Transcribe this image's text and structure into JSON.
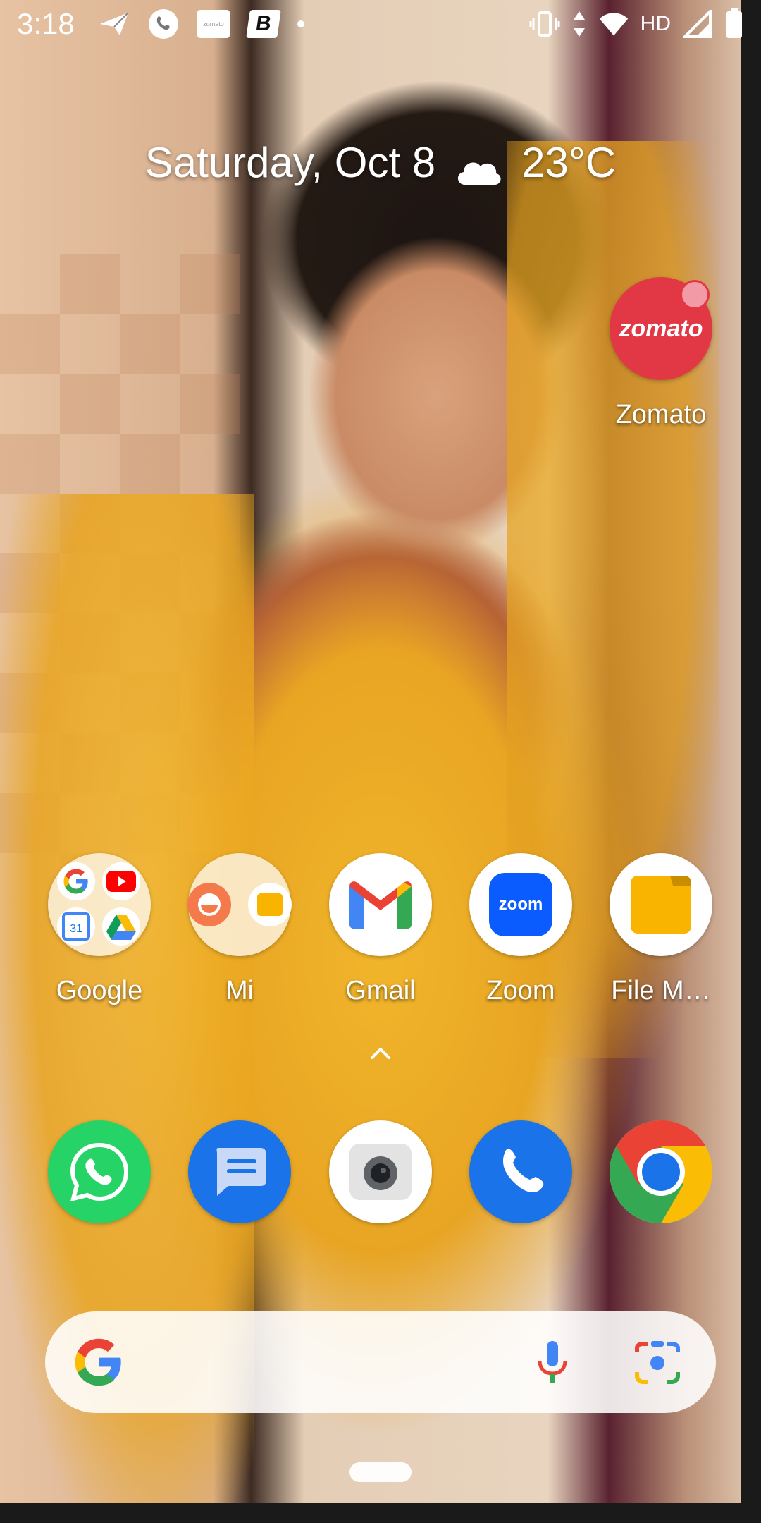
{
  "status_bar": {
    "time": "3:18",
    "left_icons": [
      "send-icon",
      "phone-call-icon",
      "zomato-notification-icon",
      "b-notification-icon",
      "more-dot-icon"
    ],
    "zomato_mini_text": "zomato",
    "b_mini_text": "B",
    "network_label": "HD",
    "right_icons": [
      "vibrate-icon",
      "data-arrows-icon",
      "wifi-icon",
      "signal-icon",
      "battery-icon"
    ]
  },
  "glance": {
    "date": "Saturday, Oct 8",
    "weather_icon": "cloud-icon",
    "temperature": "23°C"
  },
  "home_apps": [
    {
      "label": "Zomato",
      "icon": "zomato-icon",
      "has_badge": true
    }
  ],
  "app_row": [
    {
      "label": "Google",
      "icon": "google-folder-icon"
    },
    {
      "label": "Mi",
      "icon": "mi-folder-icon"
    },
    {
      "label": "Gmail",
      "icon": "gmail-icon"
    },
    {
      "label": "Zoom",
      "icon": "zoom-icon",
      "inner_text": "zoom"
    },
    {
      "label": "File M…",
      "icon": "file-manager-icon"
    }
  ],
  "dock": [
    {
      "name": "WhatsApp",
      "icon": "whatsapp-icon"
    },
    {
      "name": "Messages",
      "icon": "messages-icon"
    },
    {
      "name": "Camera",
      "icon": "camera-icon"
    },
    {
      "name": "Phone",
      "icon": "phone-icon"
    },
    {
      "name": "Chrome",
      "icon": "chrome-icon"
    }
  ],
  "search_bar": {
    "icons": [
      "google-g-icon",
      "microphone-icon",
      "google-lens-icon"
    ]
  },
  "zomato_logo_text": "zomato",
  "colors": {
    "zomato_red": "#e23744",
    "zoom_blue": "#0b5cff",
    "whatsapp_green": "#25d366",
    "messages_blue": "#1a73e8",
    "phone_blue": "#1a73e8",
    "file_yellow": "#f9b400"
  }
}
